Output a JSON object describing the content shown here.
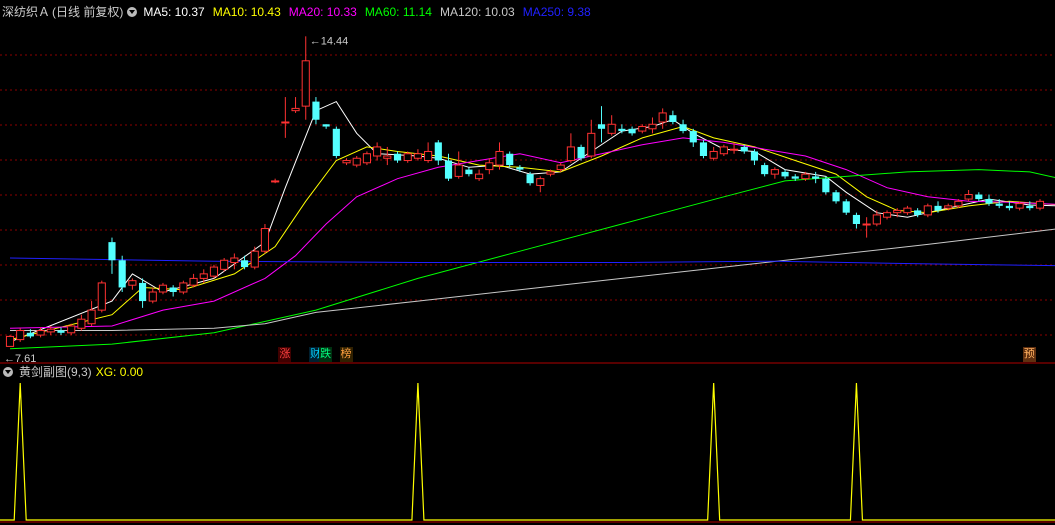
{
  "header": {
    "stock_name": "深纺织Ａ",
    "period": "(日线 前复权)",
    "ma": [
      {
        "label": "MA5: 10.37",
        "color": "#ffffff"
      },
      {
        "label": "MA10: 10.43",
        "color": "#ffff00"
      },
      {
        "label": "MA20: 10.33",
        "color": "#ff00ff"
      },
      {
        "label": "MA60: 11.14",
        "color": "#00ff00"
      },
      {
        "label": "MA120: 10.03",
        "color": "#c8c8c8"
      },
      {
        "label": "MA250: 9.38",
        "color": "#2020ff"
      }
    ]
  },
  "indicator": {
    "name": "黄剑副图(9,3)",
    "xg_label": "XG: 0.00",
    "name_color": "#c8c8c8",
    "xg_color": "#ffff00"
  },
  "events": [
    {
      "label": "涨",
      "color": "#ff4040",
      "bg": "#400000"
    },
    {
      "label": "财",
      "color": "#00d0ff",
      "bg": "#002030"
    },
    {
      "label": "跌",
      "color": "#00ff80",
      "bg": "#003010"
    },
    {
      "label": "榜",
      "color": "#ffa040",
      "bg": "#302000"
    },
    {
      "label": "预",
      "color": "#ffb060",
      "bg": "#603010"
    }
  ],
  "chart_data": {
    "type": "candlestick",
    "high_label": "14.44",
    "low_label": "7.61",
    "up_color": "#ff3232",
    "down_color": "#54ffff",
    "grid_color": "#8b0000",
    "ylim": [
      7.3,
      14.8
    ],
    "candles": [
      [
        7.6,
        7.82,
        7.61,
        7.85
      ],
      [
        7.75,
        7.95,
        7.7,
        8.0
      ],
      [
        7.9,
        7.82,
        7.78,
        7.98
      ],
      [
        7.85,
        7.95,
        7.8,
        8.02
      ],
      [
        7.92,
        7.98,
        7.85,
        8.05
      ],
      [
        7.95,
        7.9,
        7.85,
        8.02
      ],
      [
        7.9,
        8.05,
        7.85,
        8.1
      ],
      [
        8.0,
        8.2,
        7.95,
        8.3
      ],
      [
        8.1,
        8.4,
        8.05,
        8.6
      ],
      [
        8.4,
        9.0,
        8.35,
        9.05
      ],
      [
        9.9,
        9.5,
        9.2,
        10.0
      ],
      [
        9.5,
        8.9,
        8.8,
        9.6
      ],
      [
        8.95,
        9.05,
        8.85,
        9.1
      ],
      [
        9.0,
        8.6,
        8.45,
        9.1
      ],
      [
        8.6,
        8.8,
        8.55,
        8.9
      ],
      [
        8.8,
        8.95,
        8.75,
        9.0
      ],
      [
        8.9,
        8.8,
        8.7,
        8.95
      ],
      [
        8.8,
        9.0,
        8.75,
        9.05
      ],
      [
        8.95,
        9.1,
        8.9,
        9.2
      ],
      [
        9.1,
        9.2,
        9.0,
        9.3
      ],
      [
        9.15,
        9.35,
        9.1,
        9.4
      ],
      [
        9.3,
        9.5,
        9.25,
        9.55
      ],
      [
        9.45,
        9.55,
        9.3,
        9.65
      ],
      [
        9.5,
        9.35,
        9.3,
        9.6
      ],
      [
        9.35,
        9.7,
        9.3,
        9.8
      ],
      [
        9.7,
        10.2,
        9.65,
        10.3
      ],
      [
        11.25,
        11.25,
        11.2,
        11.3
      ],
      [
        12.55,
        12.55,
        12.2,
        13.1
      ],
      [
        12.8,
        12.85,
        12.75,
        13.1
      ],
      [
        12.9,
        13.9,
        12.6,
        14.44
      ],
      [
        13.0,
        12.6,
        12.5,
        13.1
      ],
      [
        12.5,
        12.45,
        12.4,
        12.5
      ],
      [
        12.4,
        11.8,
        11.75,
        12.45
      ],
      [
        11.65,
        11.7,
        11.6,
        11.75
      ],
      [
        11.6,
        11.75,
        11.55,
        11.8
      ],
      [
        11.65,
        11.85,
        11.6,
        11.9
      ],
      [
        11.8,
        12.0,
        11.7,
        12.1
      ],
      [
        11.75,
        11.8,
        11.6,
        12.0
      ],
      [
        11.85,
        11.7,
        11.65,
        11.9
      ],
      [
        11.7,
        11.85,
        11.65,
        11.9
      ],
      [
        11.75,
        11.85,
        11.7,
        11.95
      ],
      [
        11.7,
        11.9,
        11.65,
        12.1
      ],
      [
        12.1,
        11.7,
        11.6,
        12.15
      ],
      [
        11.7,
        11.3,
        11.25,
        11.85
      ],
      [
        11.35,
        11.6,
        11.3,
        11.9
      ],
      [
        11.5,
        11.4,
        11.35,
        11.55
      ],
      [
        11.3,
        11.4,
        11.25,
        11.5
      ],
      [
        11.5,
        11.65,
        11.4,
        11.75
      ],
      [
        11.6,
        11.9,
        11.5,
        12.1
      ],
      [
        11.85,
        11.6,
        11.55,
        11.9
      ],
      [
        11.55,
        11.5,
        11.45,
        11.6
      ],
      [
        11.4,
        11.2,
        11.15,
        11.45
      ],
      [
        11.15,
        11.3,
        11.0,
        11.35
      ],
      [
        11.4,
        11.45,
        11.35,
        11.5
      ],
      [
        11.5,
        11.6,
        11.45,
        11.65
      ],
      [
        11.7,
        12.0,
        11.65,
        12.3
      ],
      [
        12.0,
        11.75,
        11.7,
        12.05
      ],
      [
        11.8,
        12.3,
        11.75,
        12.6
      ],
      [
        12.5,
        12.4,
        12.1,
        12.9
      ],
      [
        12.3,
        12.5,
        12.25,
        12.7
      ],
      [
        12.4,
        12.35,
        12.3,
        12.5
      ],
      [
        12.4,
        12.3,
        12.25,
        12.45
      ],
      [
        12.35,
        12.45,
        12.3,
        12.5
      ],
      [
        12.4,
        12.5,
        12.3,
        12.65
      ],
      [
        12.55,
        12.75,
        12.4,
        12.85
      ],
      [
        12.7,
        12.55,
        12.5,
        12.8
      ],
      [
        12.5,
        12.35,
        12.3,
        12.6
      ],
      [
        12.35,
        12.1,
        12.0,
        12.4
      ],
      [
        12.1,
        11.8,
        11.75,
        12.15
      ],
      [
        11.75,
        11.9,
        11.7,
        12.0
      ],
      [
        11.85,
        12.0,
        11.8,
        12.05
      ],
      [
        11.95,
        11.95,
        11.85,
        12.1
      ],
      [
        12.0,
        11.9,
        11.85,
        12.05
      ],
      [
        11.9,
        11.7,
        11.6,
        11.95
      ],
      [
        11.6,
        11.4,
        11.35,
        11.65
      ],
      [
        11.4,
        11.5,
        11.3,
        11.55
      ],
      [
        11.45,
        11.35,
        11.3,
        11.5
      ],
      [
        11.35,
        11.3,
        11.25,
        11.4
      ],
      [
        11.3,
        11.4,
        11.25,
        11.45
      ],
      [
        11.35,
        11.3,
        11.2,
        11.45
      ],
      [
        11.3,
        11.0,
        10.95,
        11.35
      ],
      [
        11.0,
        10.8,
        10.75,
        11.05
      ],
      [
        10.8,
        10.55,
        10.5,
        10.85
      ],
      [
        10.5,
        10.3,
        10.2,
        10.55
      ],
      [
        10.3,
        10.3,
        10.0,
        10.45
      ],
      [
        10.3,
        10.5,
        10.25,
        10.6
      ],
      [
        10.45,
        10.55,
        10.4,
        10.6
      ],
      [
        10.55,
        10.6,
        10.45,
        10.65
      ],
      [
        10.55,
        10.65,
        10.5,
        10.7
      ],
      [
        10.6,
        10.5,
        10.45,
        10.65
      ],
      [
        10.5,
        10.7,
        10.45,
        10.75
      ],
      [
        10.7,
        10.6,
        10.55,
        10.8
      ],
      [
        10.65,
        10.7,
        10.6,
        10.75
      ],
      [
        10.7,
        10.8,
        10.65,
        10.85
      ],
      [
        10.85,
        10.95,
        10.8,
        11.05
      ],
      [
        10.95,
        10.85,
        10.8,
        11.0
      ],
      [
        10.85,
        10.75,
        10.7,
        10.95
      ],
      [
        10.75,
        10.7,
        10.65,
        10.85
      ],
      [
        10.7,
        10.65,
        10.6,
        10.8
      ],
      [
        10.65,
        10.75,
        10.6,
        10.8
      ],
      [
        10.7,
        10.65,
        10.6,
        10.8
      ],
      [
        10.65,
        10.8,
        10.6,
        10.85
      ]
    ],
    "ma_series": [
      {
        "name": "MA5",
        "color": "#ffffff",
        "points": [
          [
            0,
            7.7
          ],
          [
            10,
            8.6
          ],
          [
            12,
            9.2
          ],
          [
            15,
            8.8
          ],
          [
            20,
            9.1
          ],
          [
            25,
            9.9
          ],
          [
            27,
            11.1
          ],
          [
            30,
            12.8
          ],
          [
            32,
            13.0
          ],
          [
            34,
            12.3
          ],
          [
            36,
            11.85
          ],
          [
            40,
            11.8
          ],
          [
            42,
            11.75
          ],
          [
            45,
            11.55
          ],
          [
            48,
            11.6
          ],
          [
            51,
            11.4
          ],
          [
            54,
            11.45
          ],
          [
            57,
            11.9
          ],
          [
            60,
            12.35
          ],
          [
            63,
            12.45
          ],
          [
            65,
            12.6
          ],
          [
            67,
            12.3
          ],
          [
            70,
            11.95
          ],
          [
            73,
            11.9
          ],
          [
            76,
            11.5
          ],
          [
            80,
            11.35
          ],
          [
            82,
            11.0
          ],
          [
            85,
            10.55
          ],
          [
            88,
            10.45
          ],
          [
            92,
            10.65
          ],
          [
            96,
            10.85
          ],
          [
            100,
            10.72
          ],
          [
            103,
            10.7
          ]
        ]
      },
      {
        "name": "MA10",
        "color": "#ffff00",
        "points": [
          [
            0,
            7.75
          ],
          [
            10,
            8.3
          ],
          [
            13,
            8.9
          ],
          [
            17,
            8.85
          ],
          [
            22,
            9.2
          ],
          [
            26,
            9.8
          ],
          [
            29,
            10.8
          ],
          [
            32,
            11.7
          ],
          [
            35,
            12.0
          ],
          [
            38,
            11.9
          ],
          [
            42,
            11.8
          ],
          [
            46,
            11.6
          ],
          [
            50,
            11.55
          ],
          [
            54,
            11.45
          ],
          [
            58,
            11.8
          ],
          [
            62,
            12.2
          ],
          [
            66,
            12.45
          ],
          [
            69,
            12.2
          ],
          [
            73,
            12.0
          ],
          [
            77,
            11.7
          ],
          [
            81,
            11.4
          ],
          [
            84,
            10.9
          ],
          [
            87,
            10.6
          ],
          [
            90,
            10.55
          ],
          [
            94,
            10.7
          ],
          [
            98,
            10.8
          ],
          [
            103,
            10.72
          ]
        ]
      },
      {
        "name": "MA20",
        "color": "#ff00ff",
        "points": [
          [
            0,
            8.0
          ],
          [
            10,
            8.05
          ],
          [
            15,
            8.4
          ],
          [
            20,
            8.6
          ],
          [
            25,
            9.1
          ],
          [
            28,
            9.6
          ],
          [
            31,
            10.3
          ],
          [
            34,
            10.9
          ],
          [
            38,
            11.3
          ],
          [
            42,
            11.55
          ],
          [
            46,
            11.7
          ],
          [
            50,
            11.85
          ],
          [
            54,
            11.65
          ],
          [
            58,
            11.85
          ],
          [
            62,
            12.05
          ],
          [
            66,
            12.2
          ],
          [
            70,
            12.1
          ],
          [
            74,
            11.95
          ],
          [
            78,
            11.8
          ],
          [
            82,
            11.5
          ],
          [
            86,
            11.1
          ],
          [
            90,
            10.9
          ],
          [
            94,
            10.8
          ],
          [
            98,
            10.78
          ],
          [
            103,
            10.73
          ]
        ]
      },
      {
        "name": "MA60",
        "color": "#00ff00",
        "points": [
          [
            0,
            7.55
          ],
          [
            10,
            7.65
          ],
          [
            20,
            7.9
          ],
          [
            30,
            8.4
          ],
          [
            40,
            9.1
          ],
          [
            50,
            9.7
          ],
          [
            60,
            10.3
          ],
          [
            70,
            10.9
          ],
          [
            76,
            11.25
          ],
          [
            82,
            11.35
          ],
          [
            88,
            11.45
          ],
          [
            95,
            11.5
          ],
          [
            100,
            11.45
          ],
          [
            103,
            11.3
          ]
        ]
      },
      {
        "name": "MA120",
        "color": "#c8c8c8",
        "points": [
          [
            0,
            7.95
          ],
          [
            10,
            7.95
          ],
          [
            20,
            8.0
          ],
          [
            25,
            8.1
          ],
          [
            30,
            8.35
          ],
          [
            40,
            8.6
          ],
          [
            50,
            8.85
          ],
          [
            60,
            9.1
          ],
          [
            70,
            9.35
          ],
          [
            80,
            9.6
          ],
          [
            90,
            9.85
          ],
          [
            103,
            10.2
          ]
        ]
      },
      {
        "name": "MA250",
        "color": "#2020ff",
        "points": [
          [
            0,
            9.55
          ],
          [
            20,
            9.48
          ],
          [
            40,
            9.45
          ],
          [
            60,
            9.45
          ],
          [
            75,
            9.48
          ],
          [
            90,
            9.42
          ],
          [
            103,
            9.38
          ]
        ]
      }
    ],
    "xg": {
      "color": "#ffff00",
      "spikes": [
        1,
        40,
        69,
        83
      ]
    },
    "event_positions": [
      27,
      30,
      31,
      33,
      100
    ]
  }
}
